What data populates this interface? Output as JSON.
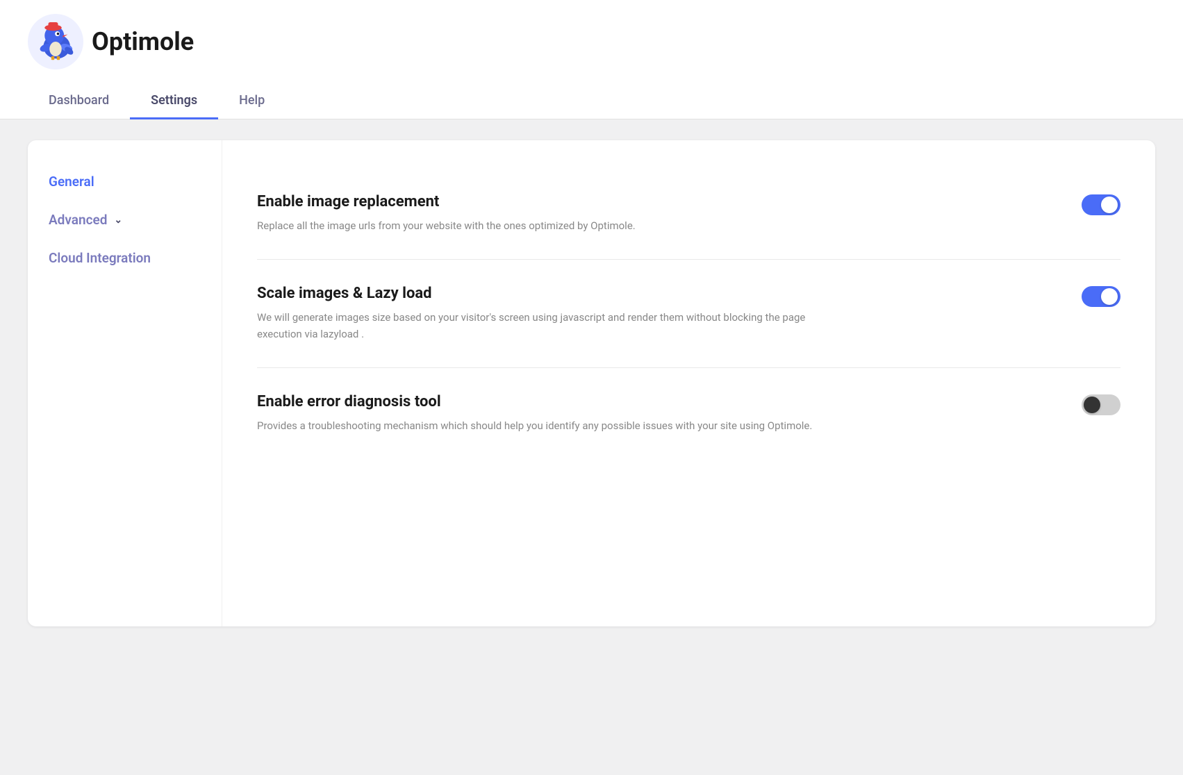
{
  "header": {
    "app_name": "Optimole",
    "tabs": [
      {
        "id": "dashboard",
        "label": "Dashboard",
        "active": false
      },
      {
        "id": "settings",
        "label": "Settings",
        "active": true
      },
      {
        "id": "help",
        "label": "Help",
        "active": false
      }
    ]
  },
  "sidebar": {
    "items": [
      {
        "id": "general",
        "label": "General",
        "active": true,
        "has_chevron": false
      },
      {
        "id": "advanced",
        "label": "Advanced",
        "active": false,
        "has_chevron": true
      },
      {
        "id": "cloud-integration",
        "label": "Cloud Integration",
        "active": false,
        "has_chevron": false
      }
    ]
  },
  "settings": [
    {
      "id": "image-replacement",
      "title": "Enable image replacement",
      "description": "Replace all the image urls from your website with the ones optimized by Optimole.",
      "enabled": true
    },
    {
      "id": "scale-lazyload",
      "title": "Scale images & Lazy load",
      "description": "We will generate images size based on your visitor's screen using javascript and render them without blocking the page execution via lazyload .",
      "enabled": true
    },
    {
      "id": "error-diagnosis",
      "title": "Enable error diagnosis tool",
      "description": "Provides a troubleshooting mechanism which should help you identify any possible issues with your site using Optimole.",
      "enabled": false
    }
  ],
  "colors": {
    "accent": "#4a6cf7",
    "sidebar_active": "#4a6cf7",
    "sidebar_inactive": "#7b7bbd",
    "toggle_on": "#4a6cf7",
    "toggle_off": "#d0d0d0"
  }
}
